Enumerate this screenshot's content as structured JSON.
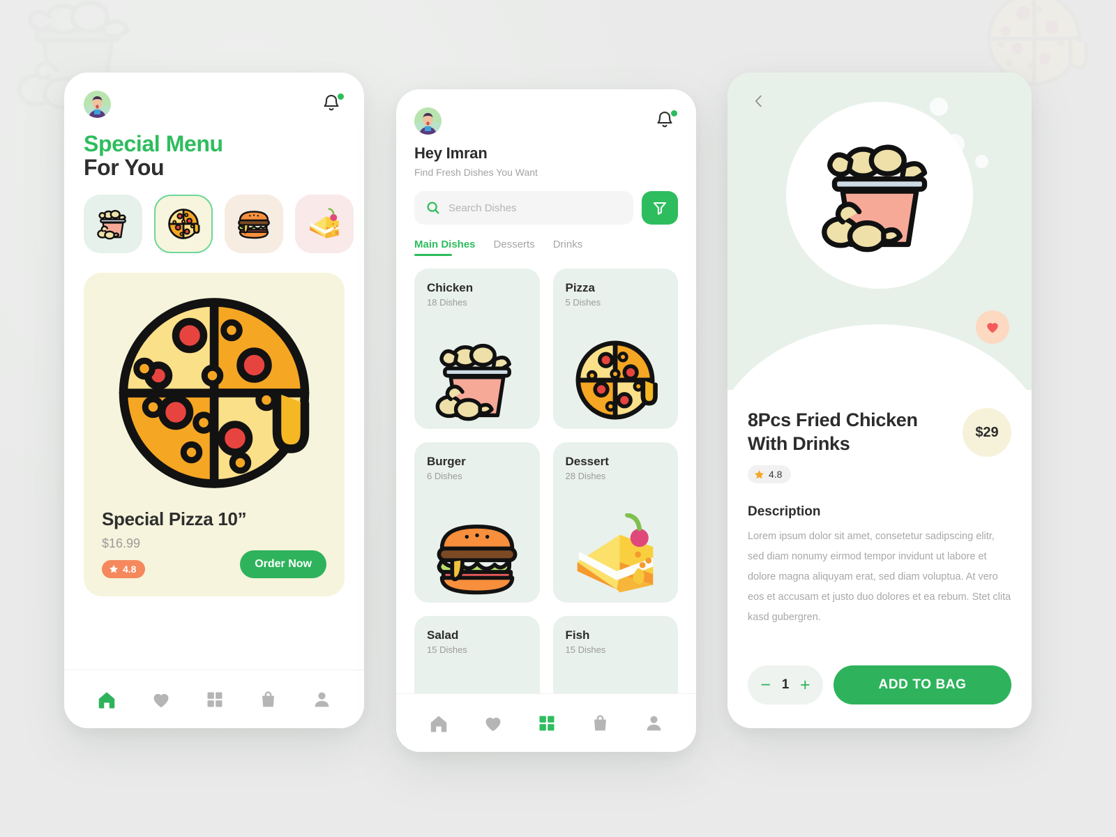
{
  "colors": {
    "brand_green": "#2ebd5e",
    "button_green": "#2eb35c",
    "rating_orange": "#f5885c",
    "star_gold": "#f5a623",
    "heart_red": "#f55b5b",
    "mint_card": "#e9f1ec",
    "cream_card": "#f6f4dc",
    "canvas": "#ebebeb"
  },
  "background": {
    "watermark_left": "chicken-bucket-watermark",
    "watermark_right": "pizza-watermark"
  },
  "phone1": {
    "avatar_alt": "user-avatar",
    "bell_icon": "bell-icon",
    "has_notification": true,
    "title_line1": "Special Menu",
    "title_line2": "For You",
    "categories": [
      {
        "icon": "chicken-bucket-icon",
        "bg": "#e7f1ec",
        "selected": false
      },
      {
        "icon": "pizza-icon",
        "bg": "#f7f5dd",
        "selected": true
      },
      {
        "icon": "burger-icon",
        "bg": "#f6ece2",
        "selected": false
      },
      {
        "icon": "cake-slice-icon",
        "bg": "#f9e9e9",
        "selected": false
      }
    ],
    "feature": {
      "image_icon": "pizza-icon",
      "name": "Special Pizza 10”",
      "price": "$16.99",
      "rating": "4.8",
      "order_label": "Order Now"
    },
    "tabs": [
      {
        "icon": "home-icon",
        "active": true
      },
      {
        "icon": "heart-icon",
        "active": false
      },
      {
        "icon": "grid-icon",
        "active": false
      },
      {
        "icon": "bag-icon",
        "active": false
      },
      {
        "icon": "profile-icon",
        "active": false
      }
    ]
  },
  "phone2": {
    "avatar_alt": "user-avatar",
    "bell_icon": "bell-icon",
    "has_notification": true,
    "greeting": "Hey Imran",
    "subtitle": "Find Fresh Dishes You Want",
    "search": {
      "value": "",
      "placeholder": "Search Dishes",
      "icon": "search-icon"
    },
    "filter_icon": "filter-icon",
    "segments": [
      {
        "label": "Main Dishes",
        "active": true
      },
      {
        "label": "Desserts",
        "active": false
      },
      {
        "label": "Drinks",
        "active": false
      }
    ],
    "categories": [
      {
        "name": "Chicken",
        "count": "18 Dishes",
        "icon": "chicken-bucket-icon"
      },
      {
        "name": "Pizza",
        "count": "5 Dishes",
        "icon": "pizza-icon"
      },
      {
        "name": "Burger",
        "count": "6 Dishes",
        "icon": "burger-icon"
      },
      {
        "name": "Dessert",
        "count": "28 Dishes",
        "icon": "cake-slice-icon"
      },
      {
        "name": "Salad",
        "count": "15 Dishes",
        "icon": "salad-icon"
      },
      {
        "name": "Fish",
        "count": "15 Dishes",
        "icon": "fish-icon"
      }
    ],
    "tabs": [
      {
        "icon": "home-icon",
        "active": false
      },
      {
        "icon": "heart-icon",
        "active": false
      },
      {
        "icon": "grid-icon",
        "active": true
      },
      {
        "icon": "bag-icon",
        "active": false
      },
      {
        "icon": "profile-icon",
        "active": false
      }
    ]
  },
  "phone3": {
    "back_icon": "chevron-left-icon",
    "hero_icon": "chicken-bucket-icon",
    "favorite_icon": "heart-icon",
    "favorite_active": true,
    "title": "8Pcs Fried Chicken With Drinks",
    "price": "$29",
    "rating": "4.8",
    "description_heading": "Description",
    "description": "Lorem ipsum dolor sit amet, consetetur sadipscing elitr, sed diam nonumy eirmod tempor invidunt ut labore et dolore magna aliquyam erat, sed diam voluptua. At vero eos et accusam et justo duo dolores et ea rebum. Stet clita kasd gubergren.",
    "quantity": "1",
    "decrement_label": "−",
    "increment_label": "+",
    "add_to_bag_label": "ADD TO BAG"
  }
}
